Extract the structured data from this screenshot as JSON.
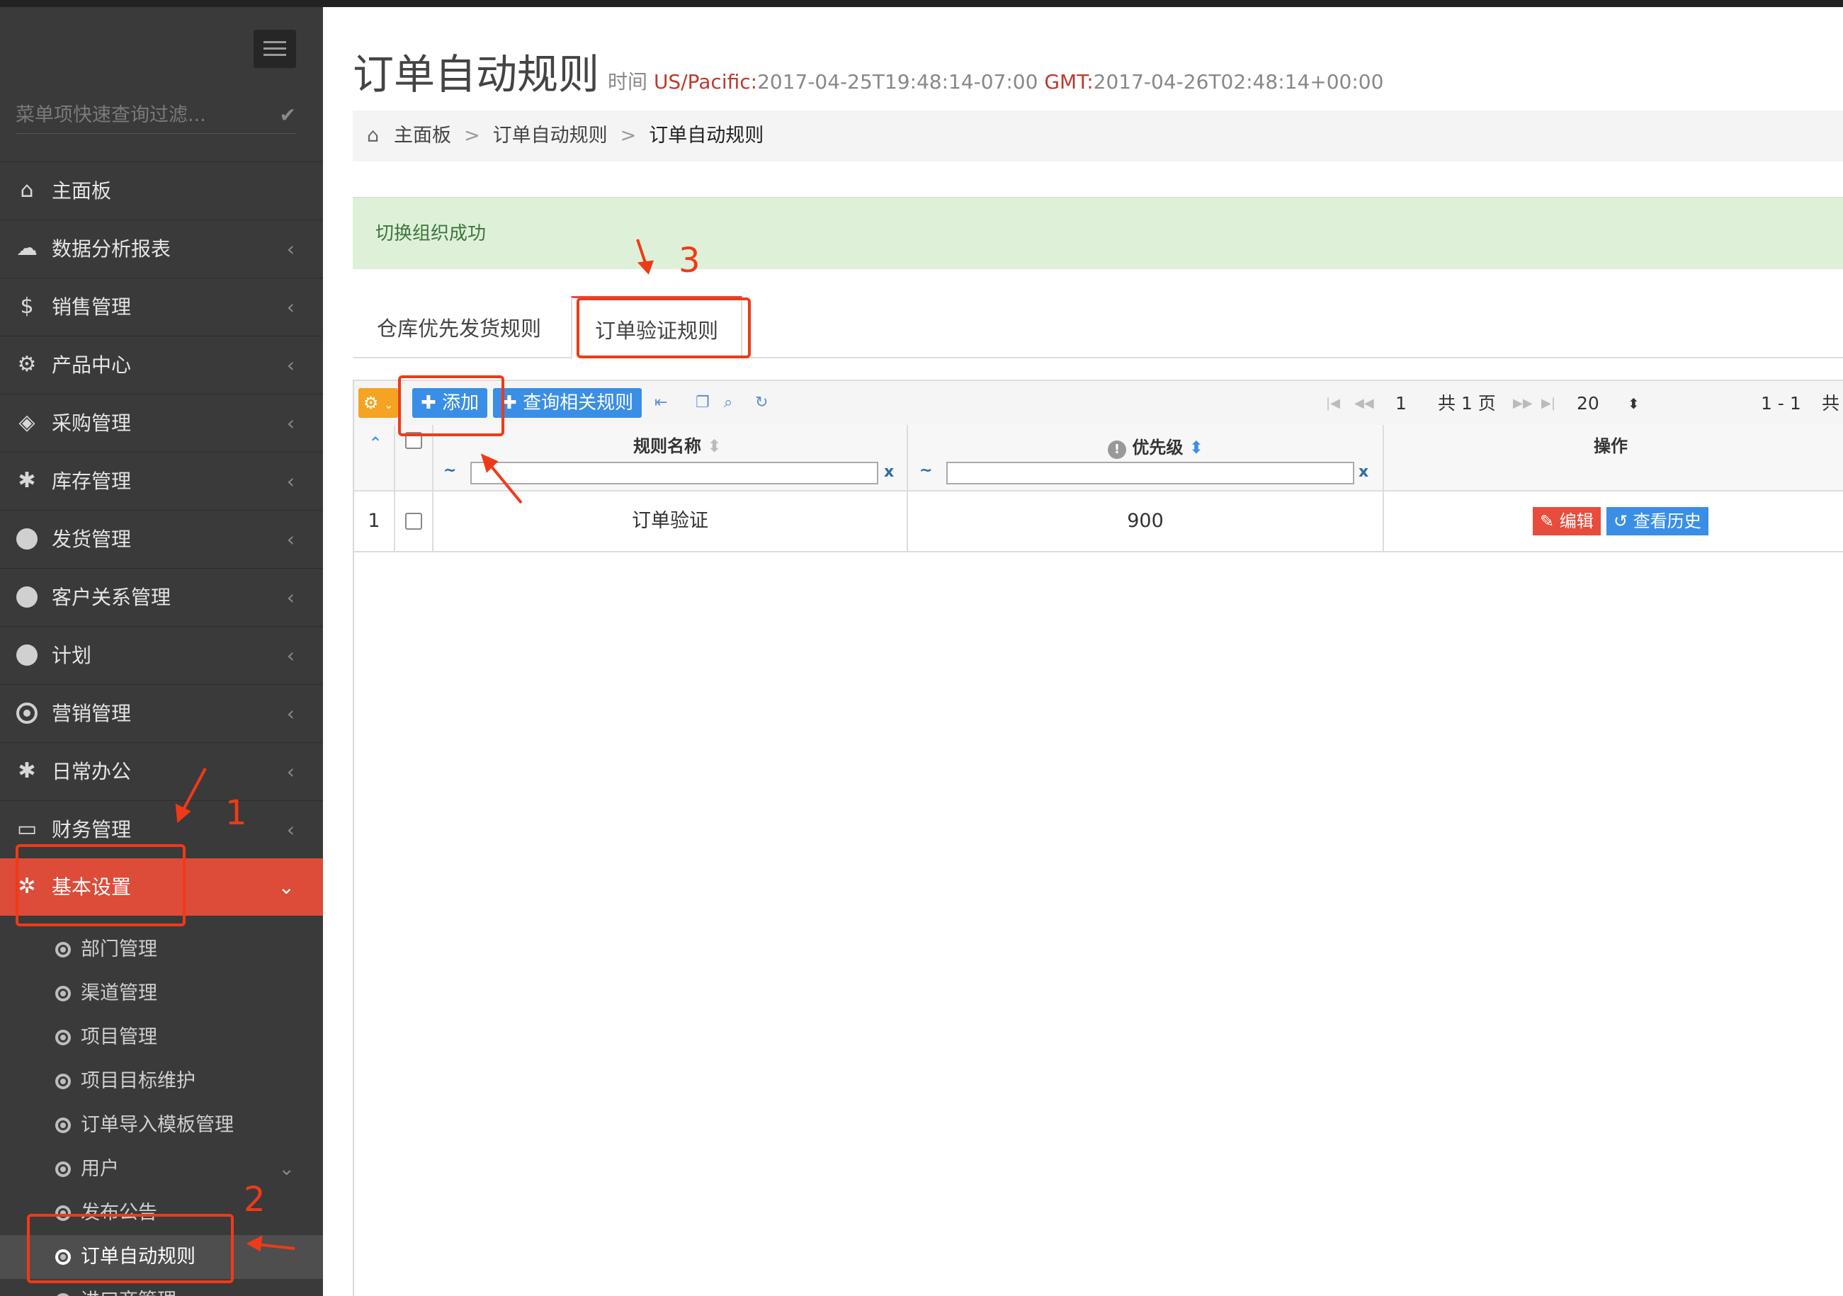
{
  "sidebar": {
    "filter_placeholder": "菜单项快速查询过滤...",
    "items": [
      {
        "label": "主面板",
        "icon": "home-icon"
      },
      {
        "label": "数据分析报表",
        "icon": "cloud-icon"
      },
      {
        "label": "销售管理",
        "icon": "dollar-icon"
      },
      {
        "label": "产品中心",
        "icon": "gears-icon"
      },
      {
        "label": "采购管理",
        "icon": "cube-icon"
      },
      {
        "label": "库存管理",
        "icon": "android-icon"
      },
      {
        "label": "发货管理",
        "icon": "circle-icon"
      },
      {
        "label": "客户关系管理",
        "icon": "circle-icon"
      },
      {
        "label": "计划",
        "icon": "circle-icon"
      },
      {
        "label": "营销管理",
        "icon": "dot-circle-icon"
      },
      {
        "label": "日常办公",
        "icon": "android-icon"
      },
      {
        "label": "财务管理",
        "icon": "credit-card-icon"
      },
      {
        "label": "基本设置",
        "icon": "cogs-icon"
      }
    ],
    "subitems": [
      {
        "label": "部门管理"
      },
      {
        "label": "渠道管理"
      },
      {
        "label": "项目管理"
      },
      {
        "label": "项目目标维护"
      },
      {
        "label": "订单导入模板管理"
      },
      {
        "label": "用户"
      },
      {
        "label": "发布公告"
      },
      {
        "label": "订单自动规则"
      },
      {
        "label": "进口商管理"
      }
    ]
  },
  "header": {
    "title": "订单自动规则",
    "time_label": "时间",
    "tz1": "US/Pacific:",
    "time1": "2017-04-25T19:48:14-07:00",
    "tz2": "GMT:",
    "time2": "2017-04-26T02:48:14+00:00"
  },
  "breadcrumb": {
    "items": [
      "主面板",
      "订单自动规则",
      "订单自动规则"
    ],
    "separator": ">"
  },
  "alert": {
    "text": "切换组织成功"
  },
  "tabs": [
    {
      "label": "仓库优先发货规则"
    },
    {
      "label": "订单验证规则"
    }
  ],
  "toolbar": {
    "add_label": "添加",
    "query_label": "查询相关规则",
    "page_input": "1",
    "page_total": "共 1 页",
    "page_size": "20",
    "range": "1 - 1",
    "total_prefix": "共"
  },
  "table": {
    "columns": [
      "规则名称",
      "优先级",
      "操作"
    ],
    "filter_tilde": "~",
    "filter_clear": "x",
    "rows": [
      {
        "index": "1",
        "name": "订单验证",
        "priority": "900",
        "edit": "编辑",
        "history": "查看历史"
      }
    ]
  },
  "annotations": {
    "n1": "1",
    "n2": "2",
    "n3": "3",
    "color": "#f03a17"
  },
  "colors": {
    "active_menu": "#dd4b39",
    "sidebar": "#3a3a3a",
    "button_blue": "#3a8ee6",
    "alert_bg": "#dff0d8"
  }
}
